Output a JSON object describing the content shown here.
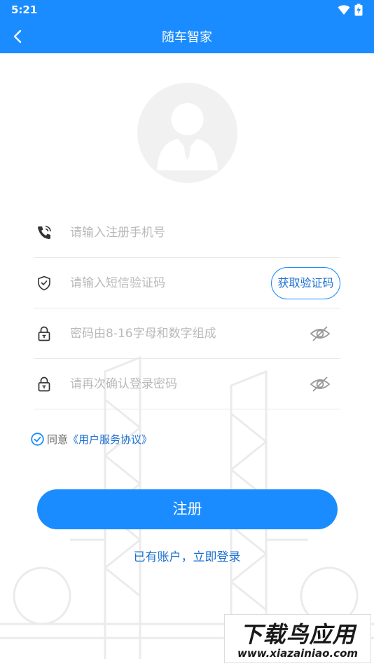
{
  "status_bar": {
    "time": "5:21",
    "icons": [
      "wifi-icon",
      "battery-charging-icon"
    ]
  },
  "app_bar": {
    "title": "随车智家",
    "back_icon": "chevron-left-icon",
    "color": "#1a8cff"
  },
  "form": {
    "phone": {
      "placeholder": "请输入注册手机号",
      "value": "",
      "icon": "phone-icon"
    },
    "sms_code": {
      "placeholder": "请输入短信验证码",
      "value": "",
      "icon": "shield-check-icon",
      "button_label": "获取验证码"
    },
    "password": {
      "placeholder": "密码由8-16字母和数字组成",
      "value": "",
      "icon": "lock-icon",
      "toggle_icon": "eye-off-icon"
    },
    "confirm_password": {
      "placeholder": "请再次确认登录密码",
      "value": "",
      "icon": "lock-icon",
      "toggle_icon": "eye-off-icon"
    }
  },
  "agreement": {
    "prefix": "同意",
    "link": "《用户服务协议》",
    "checked": true
  },
  "register_button": "注册",
  "login_link": "已有账户，立即登录",
  "watermark": {
    "title": "下载鸟应用",
    "url": "www.xiazainiao.com"
  }
}
